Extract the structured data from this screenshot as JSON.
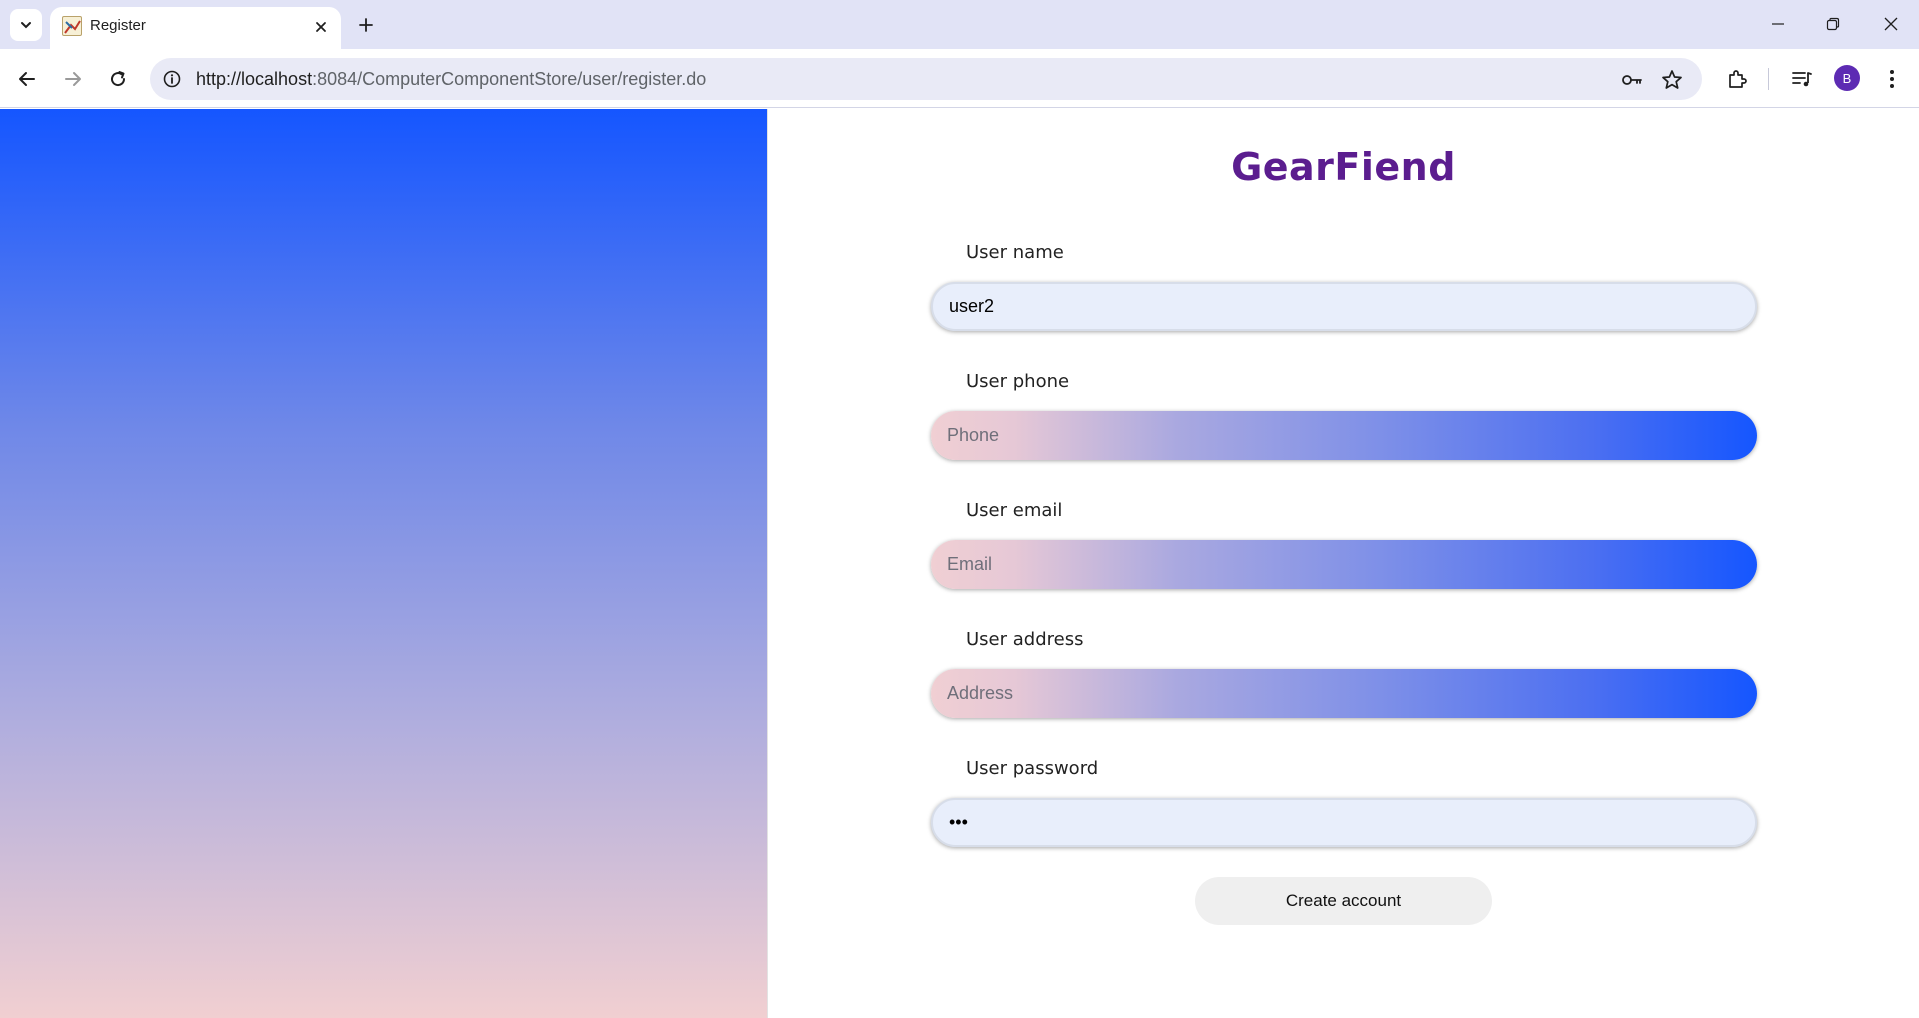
{
  "browser": {
    "tab": {
      "title": "Register"
    },
    "omnibox": {
      "url_host": "http://localhost",
      "url_rest": ":8084/ComputerComponentStore/user/register.do"
    },
    "profile_initial": "B"
  },
  "page": {
    "brand": "GearFiend",
    "fields": [
      {
        "label": "User name",
        "value": "user2",
        "placeholder": ""
      },
      {
        "label": "User phone",
        "value": "",
        "placeholder": "Phone"
      },
      {
        "label": "User email",
        "value": "",
        "placeholder": "Email"
      },
      {
        "label": "User address",
        "value": "",
        "placeholder": "Address"
      },
      {
        "label": "User password",
        "value": "123",
        "placeholder": ""
      }
    ],
    "submit_label": "Create account"
  },
  "colors": {
    "brand": "#5b1d8f",
    "gradient_top": "#1556ff",
    "gradient_bottom": "#f1cfd1",
    "avatar": "#5d2bb3"
  }
}
